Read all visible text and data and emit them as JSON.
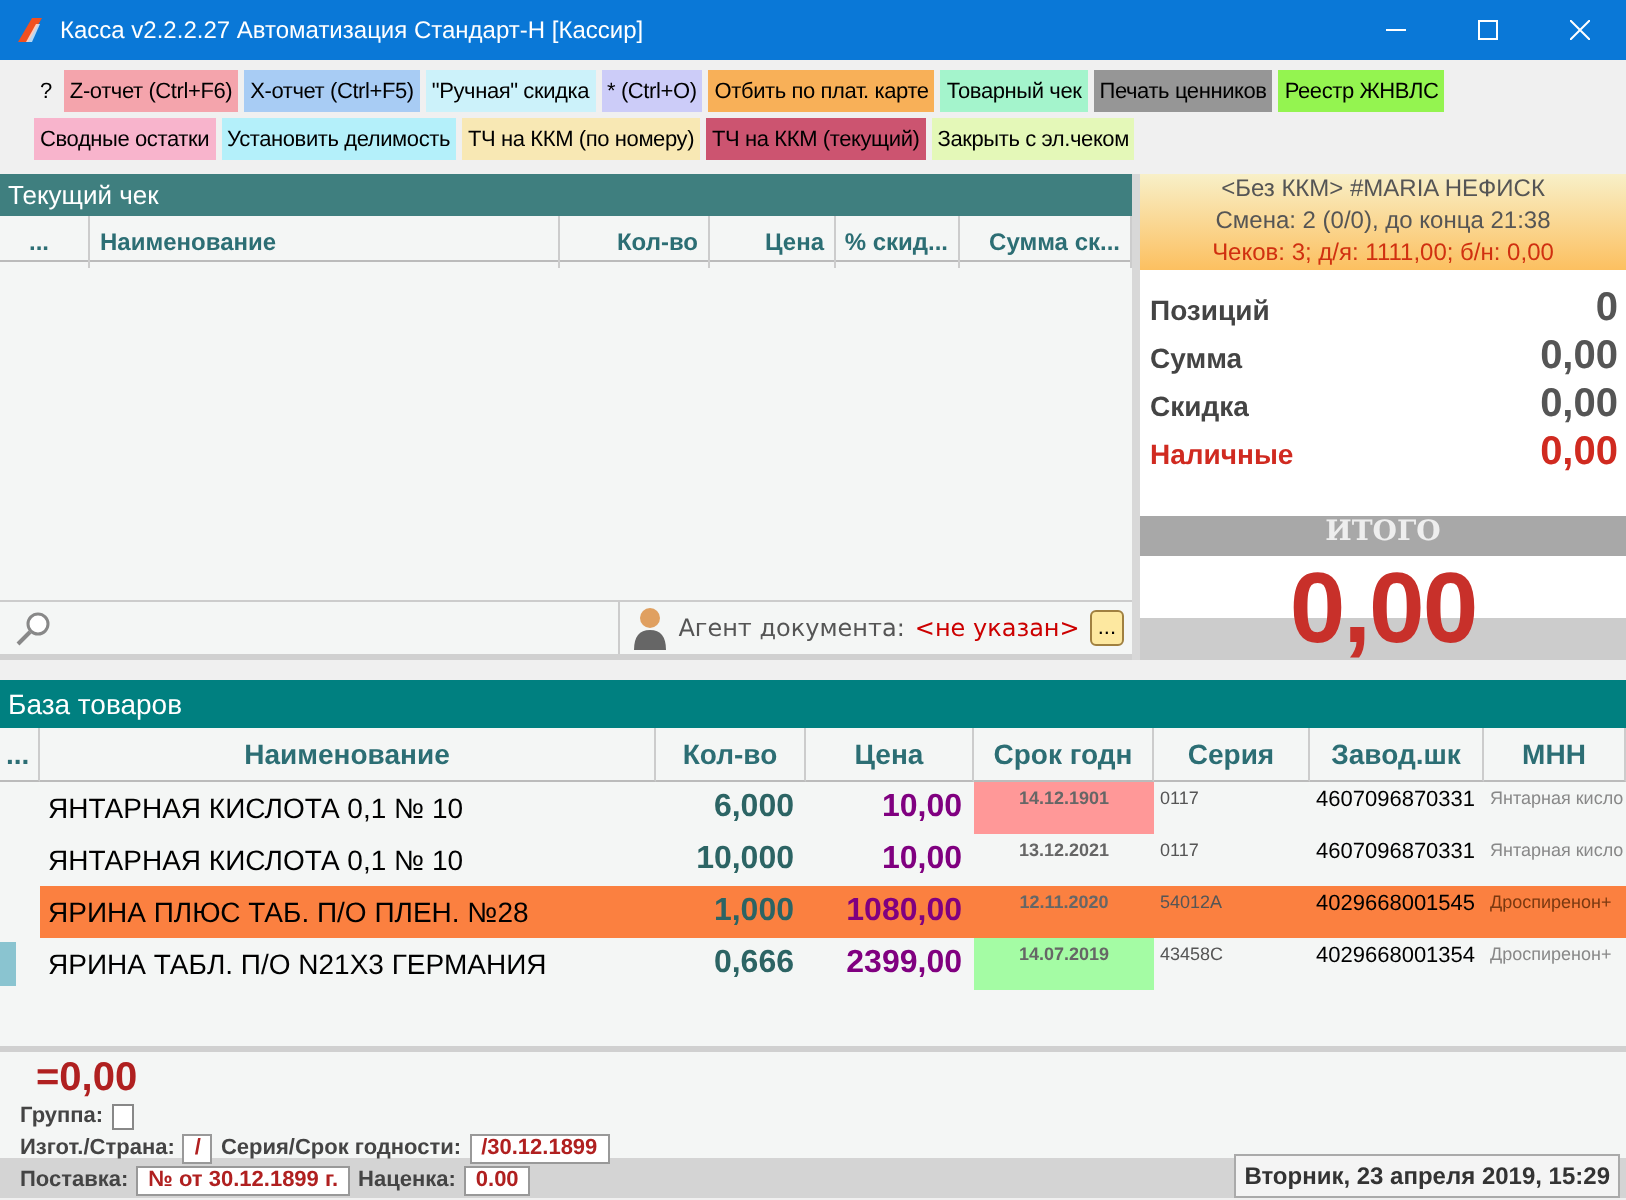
{
  "window": {
    "title": "Касса v2.2.2.27 Автоматизация Стандарт-Н [Кассир]"
  },
  "toolbar": [
    [
      {
        "label": "?",
        "color": "#f0f0f0"
      },
      {
        "label": "Z-отчет (Ctrl+F6)",
        "color": "#f4a4ac"
      },
      {
        "label": "X-отчет (Ctrl+F5)",
        "color": "#a8ccf4"
      },
      {
        "label": "\"Ручная\" скидка",
        "color": "#ccf2fa"
      },
      {
        "label": "* (Ctrl+O)",
        "color": "#ccccf8"
      },
      {
        "label": "Отбить по плат. карте",
        "color": "#f8b058"
      },
      {
        "label": "Товарный чек",
        "color": "#a4f4cc"
      },
      {
        "label": "Печать ценников",
        "color": "#969696"
      },
      {
        "label": "Реестр ЖНВЛС",
        "color": "#94f450"
      }
    ],
    [
      {
        "label": "Сводные остатки",
        "color": "#f8b4cc"
      },
      {
        "label": "Установить делимость",
        "color": "#b4f0fa"
      },
      {
        "label": "ТЧ на ККМ (по номеру)",
        "color": "#f8e8b4"
      },
      {
        "label": "ТЧ на ККМ (текущий)",
        "color": "#cc5470"
      },
      {
        "label": "Закрыть с эл.чеком",
        "color": "#e4f8b8"
      }
    ]
  ],
  "receipt": {
    "title": "Текущий чек",
    "columns": [
      "...",
      "Наименование",
      "Кол-во",
      "Цена",
      "% скид...",
      "Сумма ск..."
    ],
    "agent_label": "Агент документа:",
    "agent_value": "<не указан>",
    "agent_button": "..."
  },
  "summary": {
    "info": [
      "<Без ККМ> #MARIA НЕФИСК",
      "Смена: 2 (0/0), до конца 21:38",
      "Чеков: 3; д/я: 1111,00; б/н: 0,00"
    ],
    "rows": [
      {
        "label": "Позиций",
        "value": "0",
        "kind": "normal"
      },
      {
        "label": "Сумма",
        "value": "0,00",
        "kind": "normal"
      },
      {
        "label": "Скидка",
        "value": "0,00",
        "kind": "normal"
      },
      {
        "label": "Наличные",
        "value": "0,00",
        "kind": "alert"
      }
    ],
    "total_label": "ИТОГО",
    "total": "0,00"
  },
  "products": {
    "title": "База товаров",
    "columns": [
      "...",
      "Наименование",
      "Кол-во",
      "Цена",
      "Срок годн",
      "Серия",
      "Завод.шк",
      "МНН"
    ],
    "rows": [
      {
        "name": "ЯНТАРНАЯ КИСЛОТА 0,1 № 10",
        "qty": "6,000",
        "price": "10,00",
        "expiry": {
          "text": "14.12.1901",
          "color": "#ff9898"
        },
        "series": "0117",
        "barcode": "4607096870331",
        "mnn": "Янтарная кисло",
        "selected": false,
        "current": false
      },
      {
        "name": "ЯНТАРНАЯ КИСЛОТА 0,1 № 10",
        "qty": "10,000",
        "price": "10,00",
        "expiry": {
          "text": "13.12.2021"
        },
        "series": "0117",
        "barcode": "4607096870331",
        "mnn": "Янтарная кисло",
        "selected": false,
        "current": false
      },
      {
        "name": "ЯРИНА ПЛЮС ТАБ. П/О ПЛЕН. №28",
        "qty": "1,000",
        "price": "1080,00",
        "expiry": {
          "text": "12.11.2020"
        },
        "series": "54012A",
        "barcode": "4029668001545",
        "mnn": "Дроспиренон+",
        "selected": true,
        "current": false
      },
      {
        "name": "ЯРИНА ТАБЛ. П/О N21X3 ГЕРМАНИЯ",
        "qty": "0,666",
        "price": "2399,00",
        "expiry": {
          "text": "14.07.2019",
          "color": "#a4fca4"
        },
        "series": "43458C",
        "barcode": "4029668001354",
        "mnn": "Дроспиренон+",
        "selected": false,
        "current": true
      }
    ]
  },
  "footer": {
    "sum": "=0,00",
    "group_label": "Группа:",
    "group_checked": false,
    "maker_label": "Изгот./Страна:",
    "maker_value": "/",
    "series_label": "Серия/Срок годности:",
    "series_value": "/30.12.1899",
    "supply_label": "Поставка:",
    "supply_value": "№ от 30.12.1899 г.",
    "markup_label": "Наценка:",
    "markup_value": "0.00",
    "date": "Вторник, 23 апреля 2019, 15:29"
  }
}
